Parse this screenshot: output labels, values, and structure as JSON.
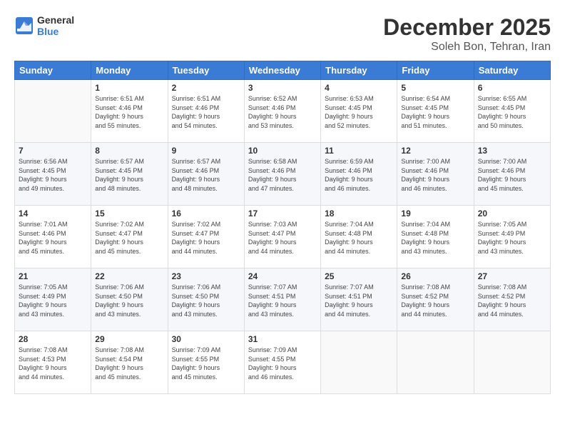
{
  "logo": {
    "general": "General",
    "blue": "Blue"
  },
  "title": "December 2025",
  "location": "Soleh Bon, Tehran, Iran",
  "days_of_week": [
    "Sunday",
    "Monday",
    "Tuesday",
    "Wednesday",
    "Thursday",
    "Friday",
    "Saturday"
  ],
  "weeks": [
    [
      {
        "day": "",
        "info": ""
      },
      {
        "day": "1",
        "info": "Sunrise: 6:51 AM\nSunset: 4:46 PM\nDaylight: 9 hours\nand 55 minutes."
      },
      {
        "day": "2",
        "info": "Sunrise: 6:51 AM\nSunset: 4:46 PM\nDaylight: 9 hours\nand 54 minutes."
      },
      {
        "day": "3",
        "info": "Sunrise: 6:52 AM\nSunset: 4:46 PM\nDaylight: 9 hours\nand 53 minutes."
      },
      {
        "day": "4",
        "info": "Sunrise: 6:53 AM\nSunset: 4:45 PM\nDaylight: 9 hours\nand 52 minutes."
      },
      {
        "day": "5",
        "info": "Sunrise: 6:54 AM\nSunset: 4:45 PM\nDaylight: 9 hours\nand 51 minutes."
      },
      {
        "day": "6",
        "info": "Sunrise: 6:55 AM\nSunset: 4:45 PM\nDaylight: 9 hours\nand 50 minutes."
      }
    ],
    [
      {
        "day": "7",
        "info": "Sunrise: 6:56 AM\nSunset: 4:45 PM\nDaylight: 9 hours\nand 49 minutes."
      },
      {
        "day": "8",
        "info": "Sunrise: 6:57 AM\nSunset: 4:45 PM\nDaylight: 9 hours\nand 48 minutes."
      },
      {
        "day": "9",
        "info": "Sunrise: 6:57 AM\nSunset: 4:46 PM\nDaylight: 9 hours\nand 48 minutes."
      },
      {
        "day": "10",
        "info": "Sunrise: 6:58 AM\nSunset: 4:46 PM\nDaylight: 9 hours\nand 47 minutes."
      },
      {
        "day": "11",
        "info": "Sunrise: 6:59 AM\nSunset: 4:46 PM\nDaylight: 9 hours\nand 46 minutes."
      },
      {
        "day": "12",
        "info": "Sunrise: 7:00 AM\nSunset: 4:46 PM\nDaylight: 9 hours\nand 46 minutes."
      },
      {
        "day": "13",
        "info": "Sunrise: 7:00 AM\nSunset: 4:46 PM\nDaylight: 9 hours\nand 45 minutes."
      }
    ],
    [
      {
        "day": "14",
        "info": "Sunrise: 7:01 AM\nSunset: 4:46 PM\nDaylight: 9 hours\nand 45 minutes."
      },
      {
        "day": "15",
        "info": "Sunrise: 7:02 AM\nSunset: 4:47 PM\nDaylight: 9 hours\nand 45 minutes."
      },
      {
        "day": "16",
        "info": "Sunrise: 7:02 AM\nSunset: 4:47 PM\nDaylight: 9 hours\nand 44 minutes."
      },
      {
        "day": "17",
        "info": "Sunrise: 7:03 AM\nSunset: 4:47 PM\nDaylight: 9 hours\nand 44 minutes."
      },
      {
        "day": "18",
        "info": "Sunrise: 7:04 AM\nSunset: 4:48 PM\nDaylight: 9 hours\nand 44 minutes."
      },
      {
        "day": "19",
        "info": "Sunrise: 7:04 AM\nSunset: 4:48 PM\nDaylight: 9 hours\nand 43 minutes."
      },
      {
        "day": "20",
        "info": "Sunrise: 7:05 AM\nSunset: 4:49 PM\nDaylight: 9 hours\nand 43 minutes."
      }
    ],
    [
      {
        "day": "21",
        "info": "Sunrise: 7:05 AM\nSunset: 4:49 PM\nDaylight: 9 hours\nand 43 minutes."
      },
      {
        "day": "22",
        "info": "Sunrise: 7:06 AM\nSunset: 4:50 PM\nDaylight: 9 hours\nand 43 minutes."
      },
      {
        "day": "23",
        "info": "Sunrise: 7:06 AM\nSunset: 4:50 PM\nDaylight: 9 hours\nand 43 minutes."
      },
      {
        "day": "24",
        "info": "Sunrise: 7:07 AM\nSunset: 4:51 PM\nDaylight: 9 hours\nand 43 minutes."
      },
      {
        "day": "25",
        "info": "Sunrise: 7:07 AM\nSunset: 4:51 PM\nDaylight: 9 hours\nand 44 minutes."
      },
      {
        "day": "26",
        "info": "Sunrise: 7:08 AM\nSunset: 4:52 PM\nDaylight: 9 hours\nand 44 minutes."
      },
      {
        "day": "27",
        "info": "Sunrise: 7:08 AM\nSunset: 4:52 PM\nDaylight: 9 hours\nand 44 minutes."
      }
    ],
    [
      {
        "day": "28",
        "info": "Sunrise: 7:08 AM\nSunset: 4:53 PM\nDaylight: 9 hours\nand 44 minutes."
      },
      {
        "day": "29",
        "info": "Sunrise: 7:08 AM\nSunset: 4:54 PM\nDaylight: 9 hours\nand 45 minutes."
      },
      {
        "day": "30",
        "info": "Sunrise: 7:09 AM\nSunset: 4:55 PM\nDaylight: 9 hours\nand 45 minutes."
      },
      {
        "day": "31",
        "info": "Sunrise: 7:09 AM\nSunset: 4:55 PM\nDaylight: 9 hours\nand 46 minutes."
      },
      {
        "day": "",
        "info": ""
      },
      {
        "day": "",
        "info": ""
      },
      {
        "day": "",
        "info": ""
      }
    ]
  ]
}
